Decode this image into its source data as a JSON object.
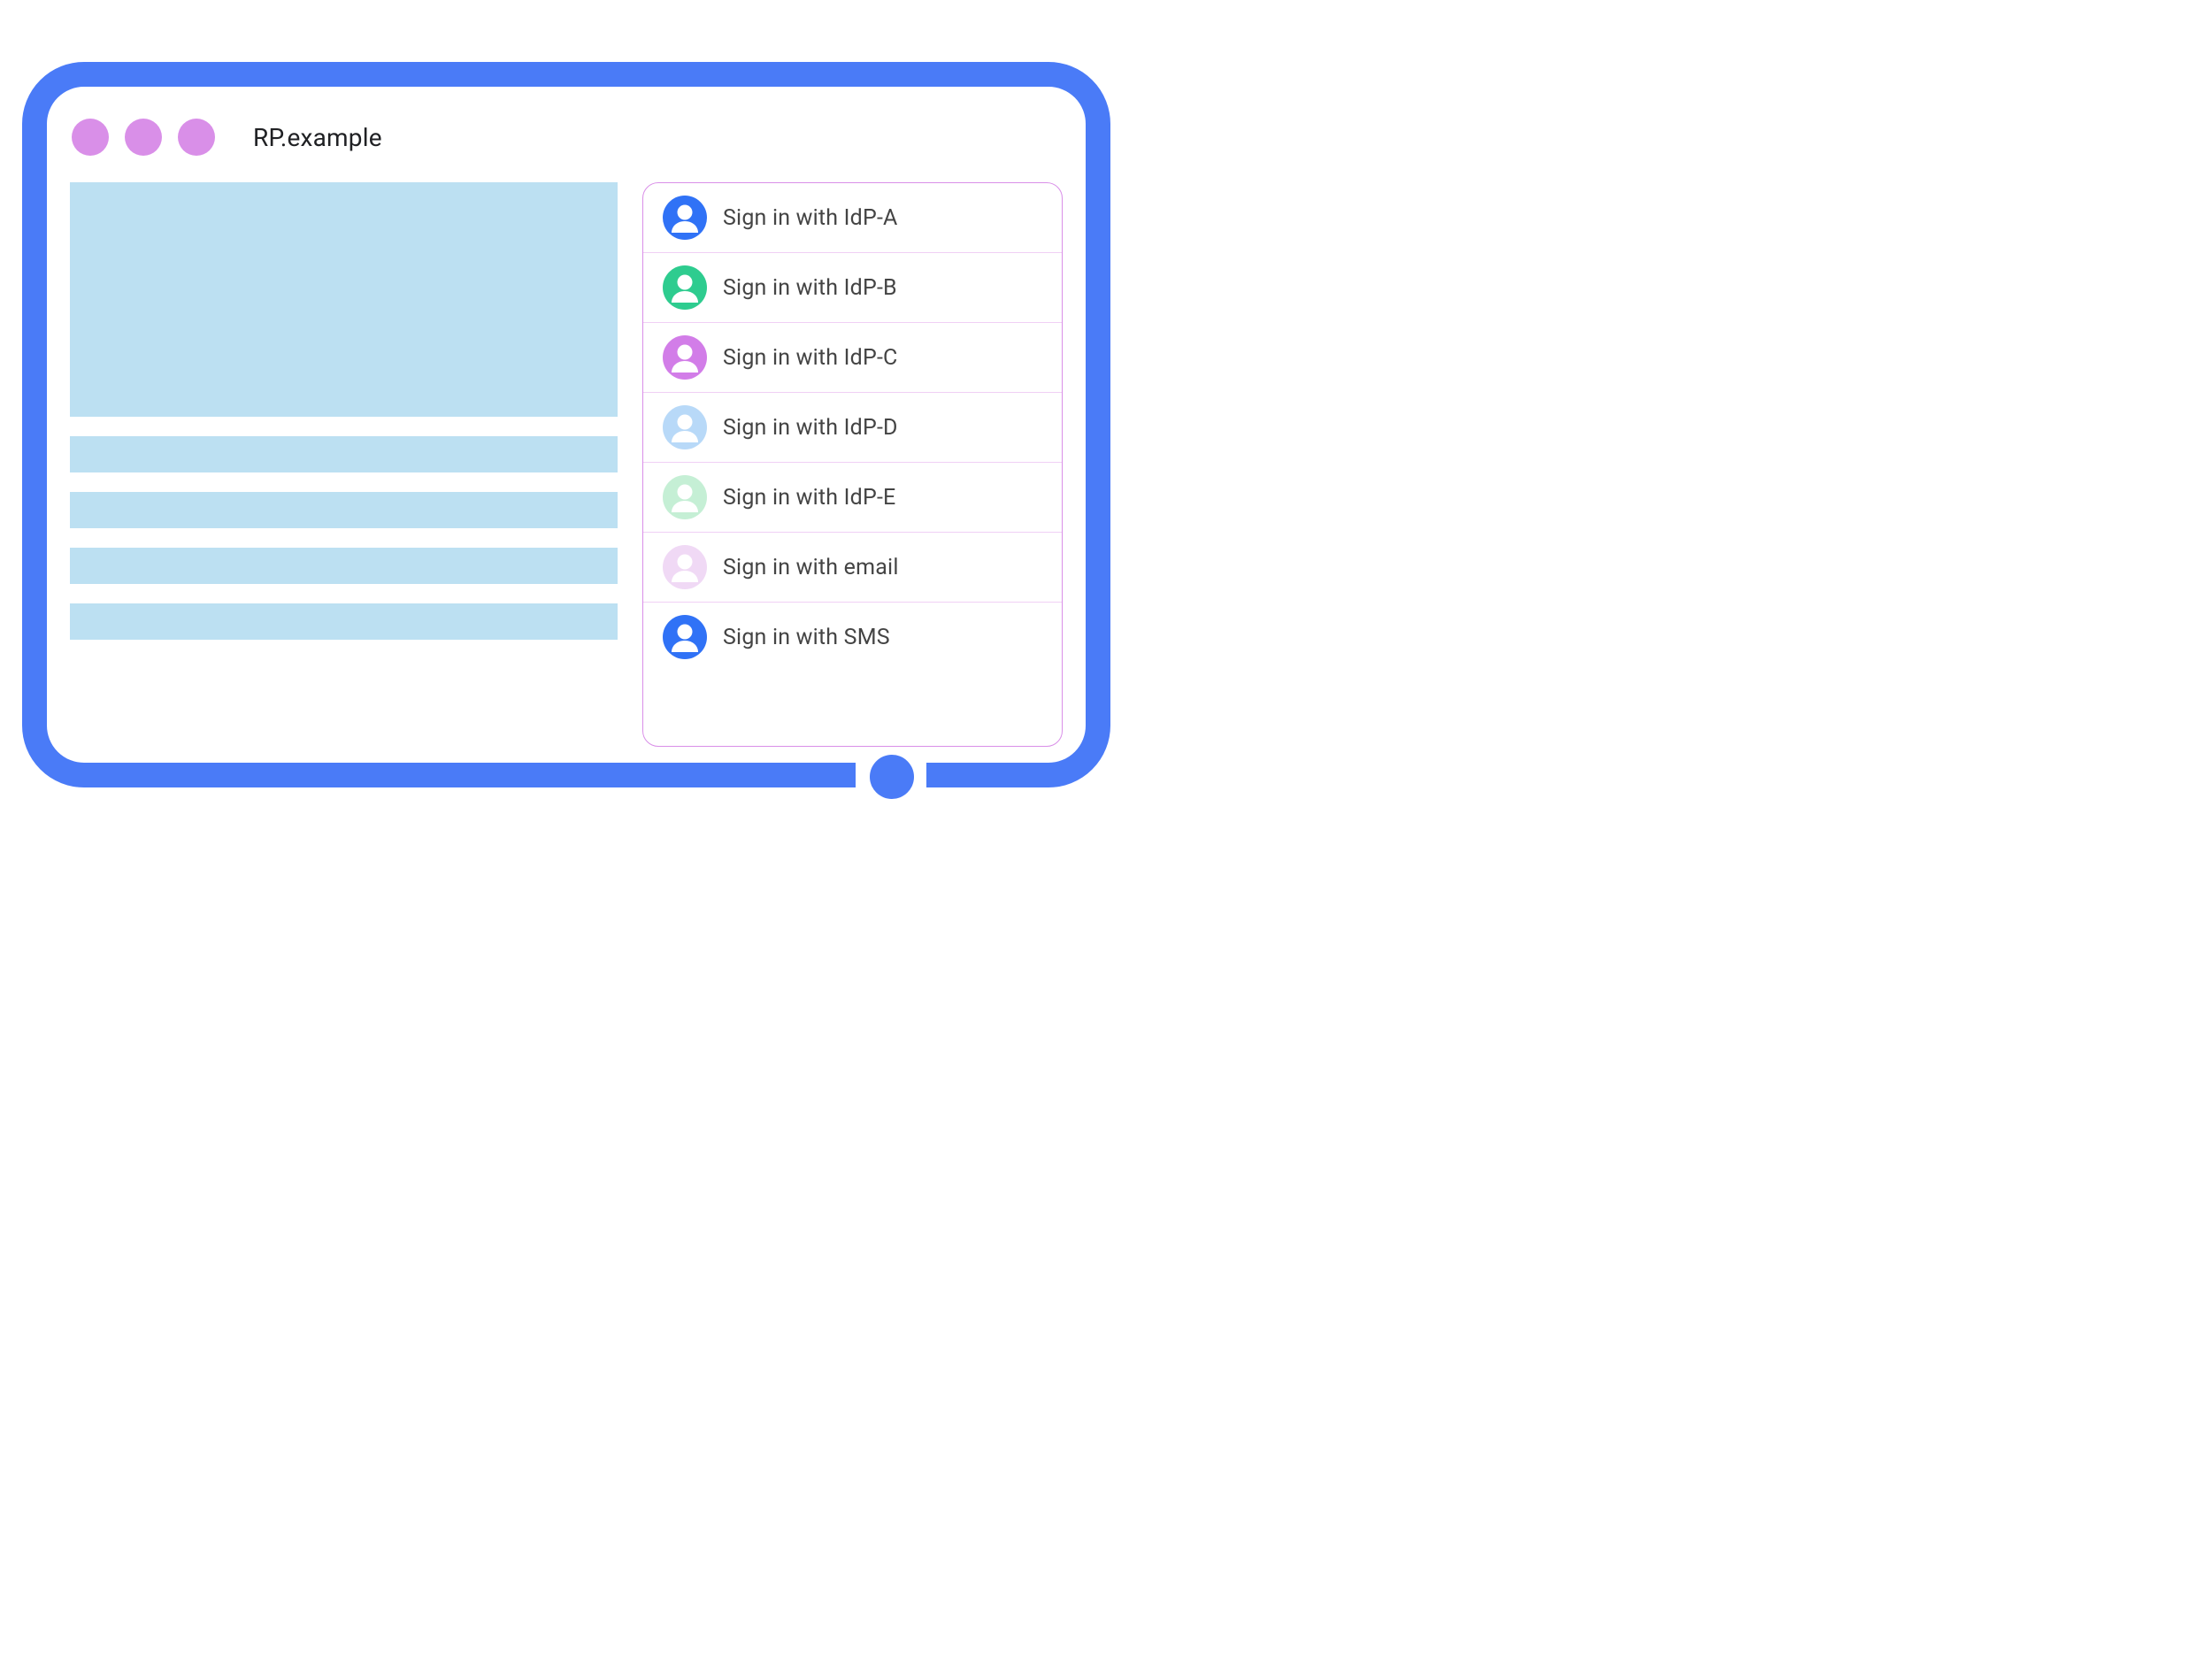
{
  "browser": {
    "url": "RP.example"
  },
  "signin_options": [
    {
      "label": "Sign in with IdP-A",
      "icon_color": "#3072F6"
    },
    {
      "label": "Sign in with IdP-B",
      "icon_color": "#2ECC8F"
    },
    {
      "label": "Sign in with IdP-C",
      "icon_color": "#D27DE8"
    },
    {
      "label": "Sign in with IdP-D",
      "icon_color": "#B8D9F8"
    },
    {
      "label": "Sign in with IdP-E",
      "icon_color": "#C5EFD5"
    },
    {
      "label": "Sign in with email",
      "icon_color": "#F0D9F5"
    },
    {
      "label": "Sign in with SMS",
      "icon_color": "#3072F6"
    }
  ]
}
